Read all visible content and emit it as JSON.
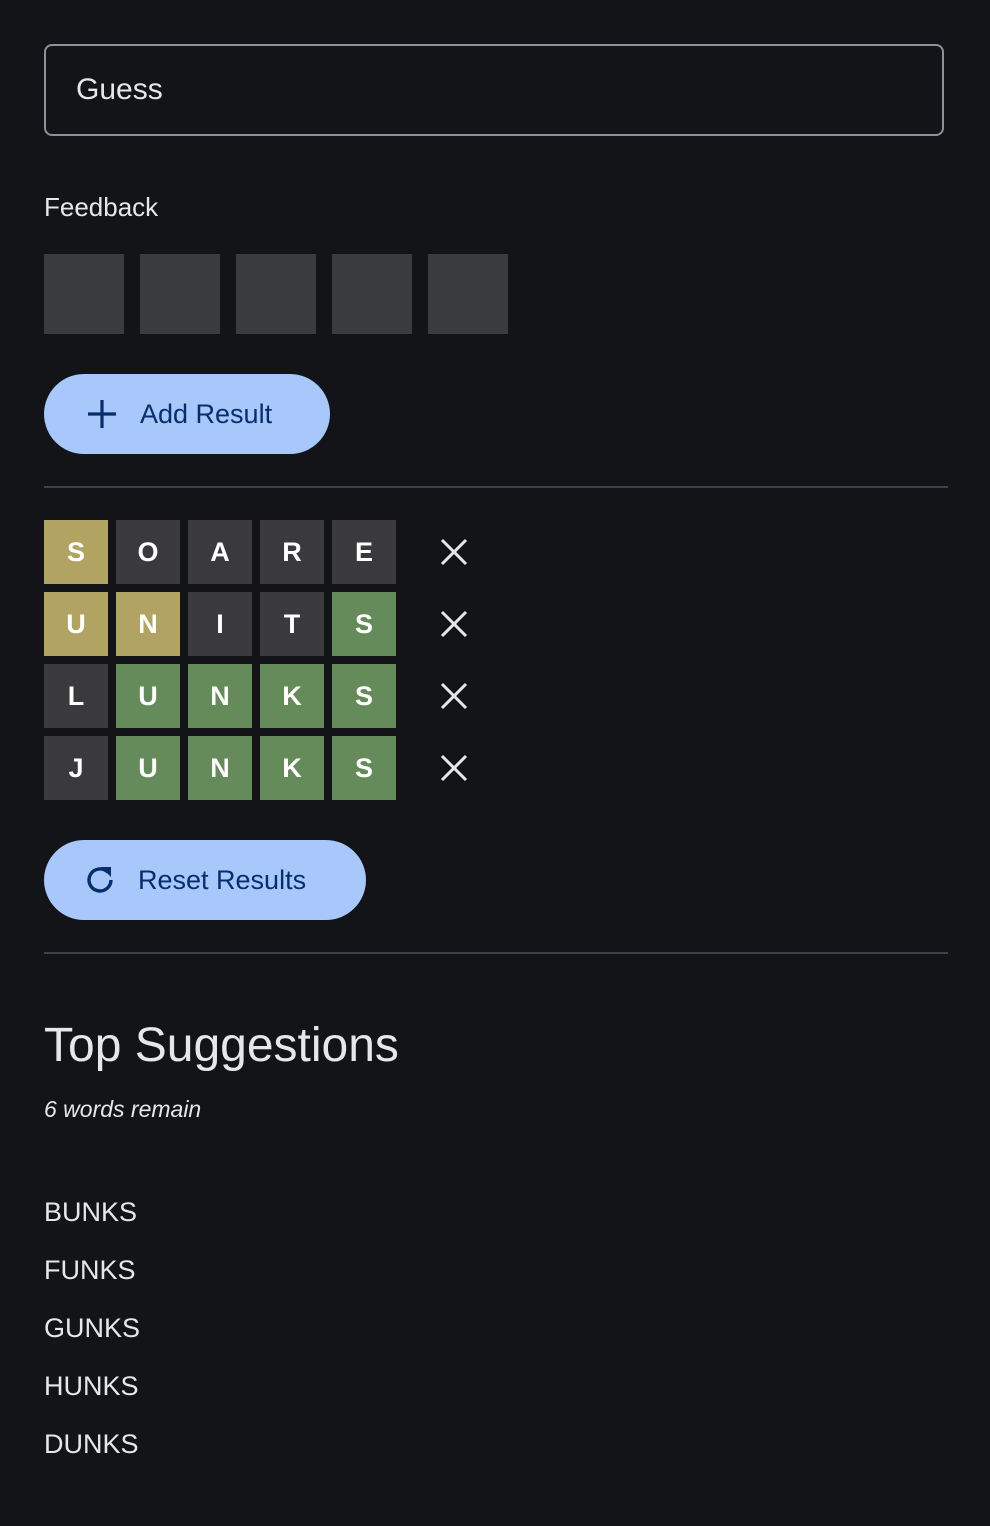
{
  "guess": {
    "placeholder": "Guess",
    "value": ""
  },
  "feedback": {
    "label": "Feedback",
    "tile_count": 5
  },
  "actions": {
    "add_result_label": "Add Result",
    "add_result_icon": "plus-icon",
    "reset_results_label": "Reset Results",
    "reset_results_icon": "refresh-icon",
    "remove_icon": "close-icon"
  },
  "colors": {
    "background": "#131417",
    "absent": "#3a3a3c",
    "present": "#b1a462",
    "correct": "#668b5a",
    "button_bg": "#a8c7fa",
    "button_text": "#062e6f"
  },
  "results": [
    {
      "letters": [
        "S",
        "O",
        "A",
        "R",
        "E"
      ],
      "states": [
        "present",
        "absent",
        "absent",
        "absent",
        "absent"
      ]
    },
    {
      "letters": [
        "U",
        "N",
        "I",
        "T",
        "S"
      ],
      "states": [
        "present",
        "present",
        "absent",
        "absent",
        "correct"
      ]
    },
    {
      "letters": [
        "L",
        "U",
        "N",
        "K",
        "S"
      ],
      "states": [
        "absent",
        "correct",
        "correct",
        "correct",
        "correct"
      ]
    },
    {
      "letters": [
        "J",
        "U",
        "N",
        "K",
        "S"
      ],
      "states": [
        "absent",
        "correct",
        "correct",
        "correct",
        "correct"
      ]
    }
  ],
  "suggestions": {
    "title": "Top Suggestions",
    "remaining_text": "6 words remain",
    "words": [
      "BUNKS",
      "FUNKS",
      "GUNKS",
      "HUNKS",
      "DUNKS"
    ]
  }
}
